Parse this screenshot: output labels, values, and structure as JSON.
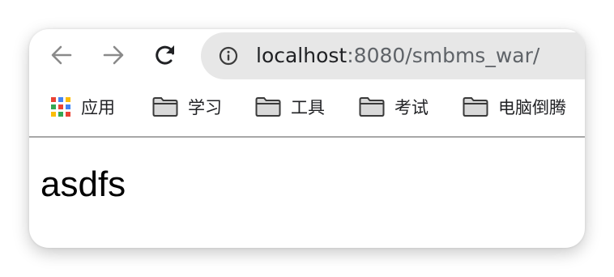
{
  "browser": {
    "url": {
      "host": "localhost",
      "rest": ":8080/smbms_war/"
    },
    "icons": {
      "back": "arrow-left-icon",
      "forward": "arrow-right-icon",
      "reload": "reload-icon",
      "info": "info-icon",
      "apps": "apps-grid-icon",
      "folder": "folder-icon"
    },
    "colors": {
      "omnibox": "#e7e7e7",
      "nav_disabled": "#8a8a8a",
      "reload": "#202124"
    }
  },
  "bookmarks": {
    "apps_label": "应用",
    "items": [
      {
        "label": "学习"
      },
      {
        "label": "工具"
      },
      {
        "label": "考试"
      },
      {
        "label": "电脑倒腾"
      }
    ]
  },
  "page": {
    "text": "asdfs"
  }
}
